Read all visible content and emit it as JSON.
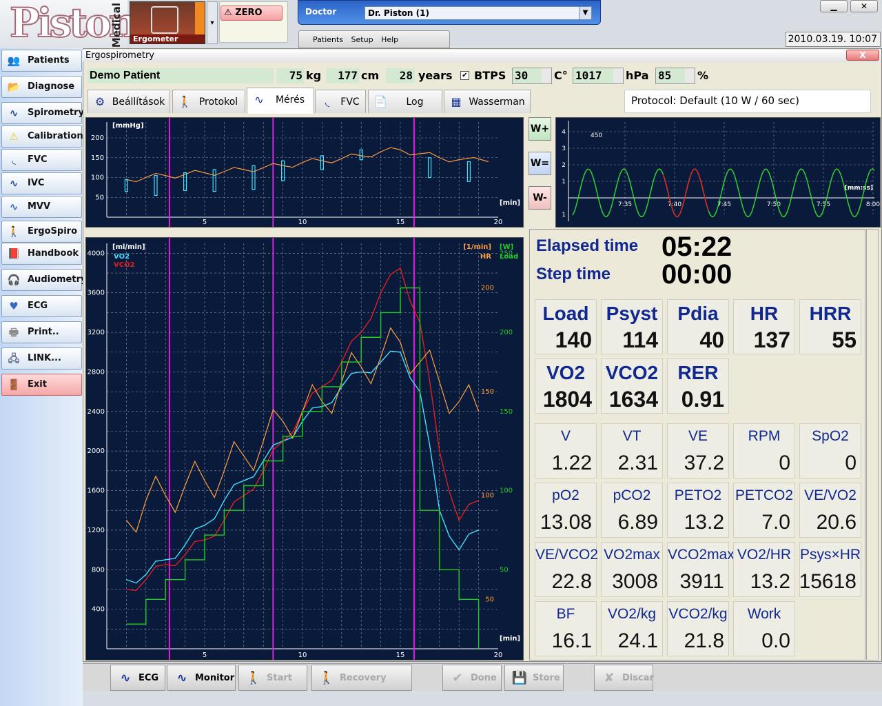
{
  "header": {
    "logo_word": "Piston",
    "logo_sub": "Medical",
    "device_label": "Ergometer",
    "zero_label": "ZERO",
    "doctor_label": "Doctor",
    "doctor_value": "Dr. Piston (1)",
    "menu": [
      "Patients",
      "Setup",
      "Help"
    ],
    "minimize": "▁",
    "close": "✕",
    "datetime": "2010.03.19. 10:07"
  },
  "sidebar": {
    "items": [
      {
        "label": "Patients",
        "icon": "👥"
      },
      {
        "label": "Diagnose",
        "icon": "📂"
      },
      {
        "label": "Spirometry",
        "icon": "∿"
      },
      {
        "label": "Calibration",
        "icon": "⚠"
      },
      {
        "label": "FVC",
        "icon": "◟"
      },
      {
        "label": "IVC",
        "icon": "∿"
      },
      {
        "label": "MVV",
        "icon": "∿"
      },
      {
        "label": "ErgoSpiro",
        "icon": "🚶"
      },
      {
        "label": "Handbook",
        "icon": "📕"
      },
      {
        "label": "Audiometry",
        "icon": "🎧"
      },
      {
        "label": "ECG",
        "icon": "♥"
      },
      {
        "label": "Print..",
        "icon": "🖶"
      },
      {
        "label": "LINK...",
        "icon": "🖧"
      },
      {
        "label": "Exit",
        "icon": "🚪"
      }
    ]
  },
  "window": {
    "title": "Ergospirometry",
    "close": "X"
  },
  "patient": {
    "name": "Demo Patient",
    "weight": "75",
    "weight_unit": "kg",
    "height": "177",
    "height_unit": "cm",
    "age": "28",
    "age_unit": "years",
    "btps_label": "BTPS",
    "temp": "30",
    "temp_unit": "C°",
    "pressure": "1017",
    "pressure_unit": "hPa",
    "humidity": "85",
    "humidity_unit": "%"
  },
  "tabs": [
    {
      "label": "Beállítások",
      "icon": "⚙"
    },
    {
      "label": "Protokol",
      "icon": "🚶"
    },
    {
      "label": "Mérés",
      "icon": "∿"
    },
    {
      "label": "FVC",
      "icon": "◟"
    },
    {
      "label": "Log",
      "icon": "📄"
    },
    {
      "label": "Wasserman",
      "icon": "▦"
    }
  ],
  "protocol_text": "Protocol: Default (10 W / 60 sec)",
  "wbuttons": [
    "W+",
    "W=",
    "W-"
  ],
  "colors": {
    "vo2": "#40e0ff",
    "vco2": "#e02020",
    "hr": "#ffa040",
    "load": "#20d020",
    "bp": "#ff9a40",
    "marker": "#e020e0"
  },
  "chart_data": [
    {
      "type": "line",
      "name": "blood-pressure",
      "ylabel": "[mmHg]",
      "xlabel": "[min]",
      "xlim": [
        0,
        20
      ],
      "ylim": [
        0,
        240
      ],
      "xticks": [
        5,
        10,
        15,
        20
      ],
      "yticks": [
        50,
        100,
        150,
        200
      ],
      "x": [
        1,
        2,
        3,
        4,
        5,
        6,
        7,
        8,
        9,
        10,
        11,
        12,
        13,
        14,
        15,
        16,
        17,
        18,
        19.5
      ],
      "y": [
        95,
        100,
        105,
        108,
        112,
        115,
        120,
        125,
        130,
        138,
        142,
        148,
        155,
        165,
        170,
        160,
        150,
        145,
        140
      ],
      "diastolic_x": [
        1,
        2.5,
        4,
        5.5,
        7.5,
        9,
        11,
        13,
        16.5,
        18.5
      ],
      "diastolic_y": [
        80,
        60,
        65,
        55,
        50,
        60,
        75,
        85,
        60,
        60
      ],
      "markers_x": [
        3.2,
        8.5,
        15.7
      ]
    },
    {
      "type": "line",
      "name": "gas-exchange",
      "ylabel": "[ml/min]",
      "ylabel_right": "[1/min]",
      "ylabel_right2": "[W]",
      "xlabel": "[min]",
      "xlim": [
        0,
        20
      ],
      "ylim": [
        0,
        4100
      ],
      "xticks": [
        5,
        10,
        15,
        20
      ],
      "yticks": [
        400,
        800,
        1200,
        1600,
        2000,
        2400,
        2800,
        3200,
        3600,
        4000
      ],
      "hr_ticks": [
        "50",
        "100",
        "150",
        "200",
        "250"
      ],
      "load_ticks": [
        "50",
        "100",
        "150",
        "200",
        "250"
      ],
      "legend": [
        "VO2",
        "VCO2"
      ],
      "legend_right": [
        "HR",
        "Load"
      ],
      "series": [
        {
          "name": "VO2",
          "x": [
            1,
            2,
            3,
            4,
            5,
            6,
            7,
            8,
            9,
            10,
            11,
            12,
            13,
            14,
            15,
            16,
            17,
            18,
            19
          ],
          "y": [
            700,
            750,
            900,
            1050,
            1250,
            1500,
            1700,
            1900,
            2100,
            2300,
            2450,
            2650,
            2800,
            2900,
            3000,
            2600,
            1400,
            1000,
            1200
          ]
        },
        {
          "name": "VCO2",
          "x": [
            1,
            2,
            3,
            4,
            5,
            6,
            7,
            8,
            9,
            10,
            11,
            12,
            13,
            14,
            15,
            16,
            17,
            18,
            19
          ],
          "y": [
            600,
            700,
            850,
            950,
            1100,
            1300,
            1550,
            1800,
            2100,
            2400,
            2650,
            2900,
            3200,
            3600,
            3850,
            3300,
            2000,
            1300,
            1500
          ]
        },
        {
          "name": "HR",
          "x": [
            1,
            2,
            3,
            4,
            5,
            6,
            7,
            8,
            9,
            10,
            11,
            12,
            13,
            14,
            15,
            16,
            17,
            18,
            19
          ],
          "y": [
            1300,
            1500,
            1550,
            1650,
            1700,
            1800,
            1950,
            2100,
            2300,
            2400,
            2500,
            2700,
            2850,
            2950,
            3100,
            2900,
            2700,
            2500,
            2400
          ]
        },
        {
          "name": "Load",
          "x": [
            1,
            2,
            3,
            4,
            5,
            6,
            7,
            8,
            9,
            10,
            11,
            12,
            13,
            14,
            15,
            16,
            17,
            18,
            19
          ],
          "y": [
            250,
            500,
            700,
            900,
            1150,
            1400,
            1650,
            1900,
            2150,
            2400,
            2650,
            2900,
            3150,
            3400,
            3650,
            1400,
            800,
            500,
            0
          ]
        }
      ],
      "markers_x": [
        3.2,
        8.5,
        15.7
      ]
    },
    {
      "type": "line",
      "name": "breathing-volume",
      "ylabel": "[mm:ss]",
      "annotation": "450",
      "xlim": [
        0,
        6
      ],
      "ylim": [
        -1,
        4
      ],
      "xticks": [
        "7:35",
        "7:40",
        "7:45",
        "7:50",
        "7:55",
        "8:00"
      ],
      "yticks": [
        "1",
        "2",
        "3",
        "4"
      ],
      "cycles": 8.5,
      "amplitude": 2.9
    }
  ],
  "values": {
    "elapsed_label": "Elapsed time",
    "elapsed": "05:22",
    "step_label": "Step time",
    "step": "00:00",
    "big": [
      {
        "label": "Load",
        "value": "140"
      },
      {
        "label": "Psyst",
        "value": "114"
      },
      {
        "label": "Pdia",
        "value": "40"
      },
      {
        "label": "HR",
        "value": "137"
      },
      {
        "label": "HRR",
        "value": "55"
      },
      {
        "label": "VO2",
        "value": "1804"
      },
      {
        "label": "VCO2",
        "value": "1634"
      },
      {
        "label": "RER",
        "value": "0.91"
      }
    ],
    "small": [
      {
        "label": "V",
        "value": "1.22"
      },
      {
        "label": "VT",
        "value": "2.31"
      },
      {
        "label": "VE",
        "value": "37.2"
      },
      {
        "label": "RPM",
        "value": "0"
      },
      {
        "label": "SpO2",
        "value": "0"
      },
      {
        "label": "pO2",
        "value": "13.08"
      },
      {
        "label": "pCO2",
        "value": "6.89"
      },
      {
        "label": "PETO2",
        "value": "13.2"
      },
      {
        "label": "PETCO2",
        "value": "7.0"
      },
      {
        "label": "VE/VO2",
        "value": "20.6"
      },
      {
        "label": "VE/VCO2",
        "value": "22.8"
      },
      {
        "label": "VO2max",
        "value": "3008"
      },
      {
        "label": "VCO2max",
        "value": "3911"
      },
      {
        "label": "VO2/HR",
        "value": "13.2"
      },
      {
        "label": "Psys×HR",
        "value": "15618"
      },
      {
        "label": "BF",
        "value": "16.1"
      },
      {
        "label": "VO2/kg",
        "value": "24.1"
      },
      {
        "label": "VCO2/kg",
        "value": "21.8"
      },
      {
        "label": "Work",
        "value": "0.0"
      }
    ]
  },
  "bottom": [
    {
      "label": "ECG",
      "icon": "∿",
      "enabled": true
    },
    {
      "label": "Monitor",
      "icon": "∿",
      "enabled": true
    },
    {
      "label": "Start",
      "icon": "🚶",
      "enabled": false
    },
    {
      "label": "Recovery",
      "icon": "🚶",
      "enabled": false
    },
    {
      "label": "Done",
      "icon": "✔",
      "enabled": false
    },
    {
      "label": "Store",
      "icon": "💾",
      "enabled": false
    },
    {
      "label": "Discar",
      "icon": "✘",
      "enabled": false
    }
  ]
}
